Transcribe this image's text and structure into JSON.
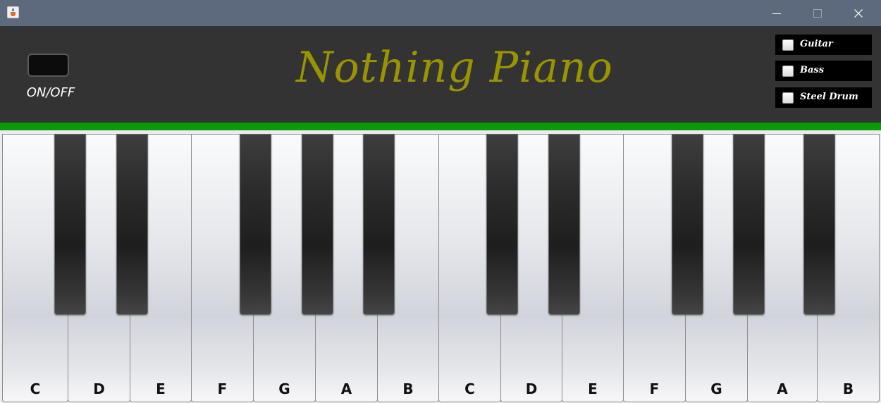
{
  "window": {
    "title_bar_color": "#5d6a7d",
    "controls": [
      "minimize-icon",
      "maximize-icon",
      "close-icon"
    ]
  },
  "header": {
    "title": "Nothing Piano",
    "title_color": "#9a9400",
    "power_label": "ON/OFF",
    "instruments": [
      {
        "label": "Guitar",
        "checked": false
      },
      {
        "label": "Bass",
        "checked": false
      },
      {
        "label": "Steel Drum",
        "checked": false
      }
    ]
  },
  "accent_color": "#0a9a0a",
  "keyboard": {
    "white_keys": [
      "C",
      "D",
      "E",
      "F",
      "G",
      "A",
      "B",
      "C",
      "D",
      "E",
      "F",
      "G",
      "A",
      "B"
    ]
  }
}
